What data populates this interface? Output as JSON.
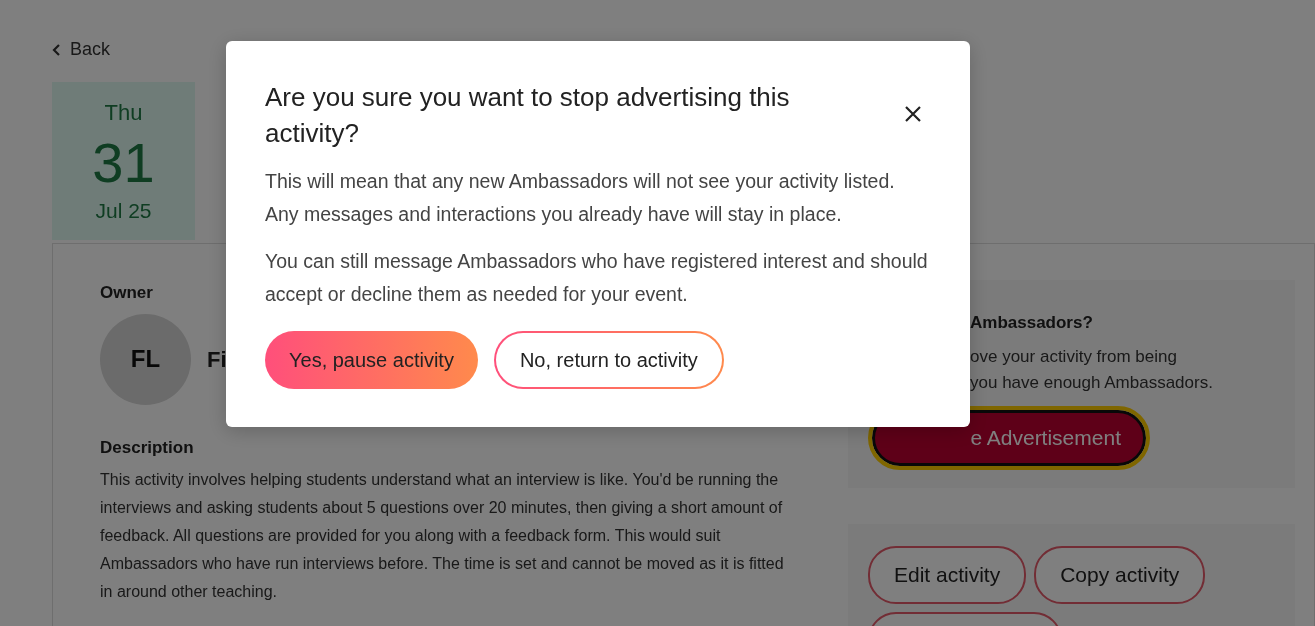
{
  "back_link": {
    "label": "Back"
  },
  "date": {
    "weekday": "Thu",
    "day": "31",
    "month_year": "Jul 25"
  },
  "owner": {
    "heading": "Owner",
    "initials": "FL",
    "name": "Fi"
  },
  "description": {
    "heading": "Description",
    "text": "This activity involves helping students understand what an interview is like. You'd be running the interviews and asking students about 5 questions over 20 minutes, then giving a short amount of feedback. All questions are provided for you along with a feedback form. This would suit Ambassadors who have run interviews before. The time is set and cannot be moved as it is fitted in around other teaching."
  },
  "advertising_panel": {
    "heading": "Ambassadors?",
    "text_lines": [
      "ove your activity from being",
      "you have enough Ambassadors."
    ],
    "button": "e Advertisement"
  },
  "actions": [
    {
      "kind": "button",
      "label": "Edit activity"
    },
    {
      "kind": "button",
      "label": "Copy activity"
    },
    {
      "kind": "cut"
    }
  ],
  "modal": {
    "title": "Are you sure you want to stop advertising this activity?",
    "paragraphs": [
      "This will mean that any new Ambassadors will not see your activity listed. Any messages and interactions you already have will stay in place.",
      "You can still message Ambassadors who have registered interest and should accept or decline them as needed for your event."
    ],
    "buttons": [
      {
        "kind": "primary",
        "label": "Yes, pause activity"
      },
      {
        "kind": "secondary",
        "label": "No, return to activity"
      }
    ]
  }
}
